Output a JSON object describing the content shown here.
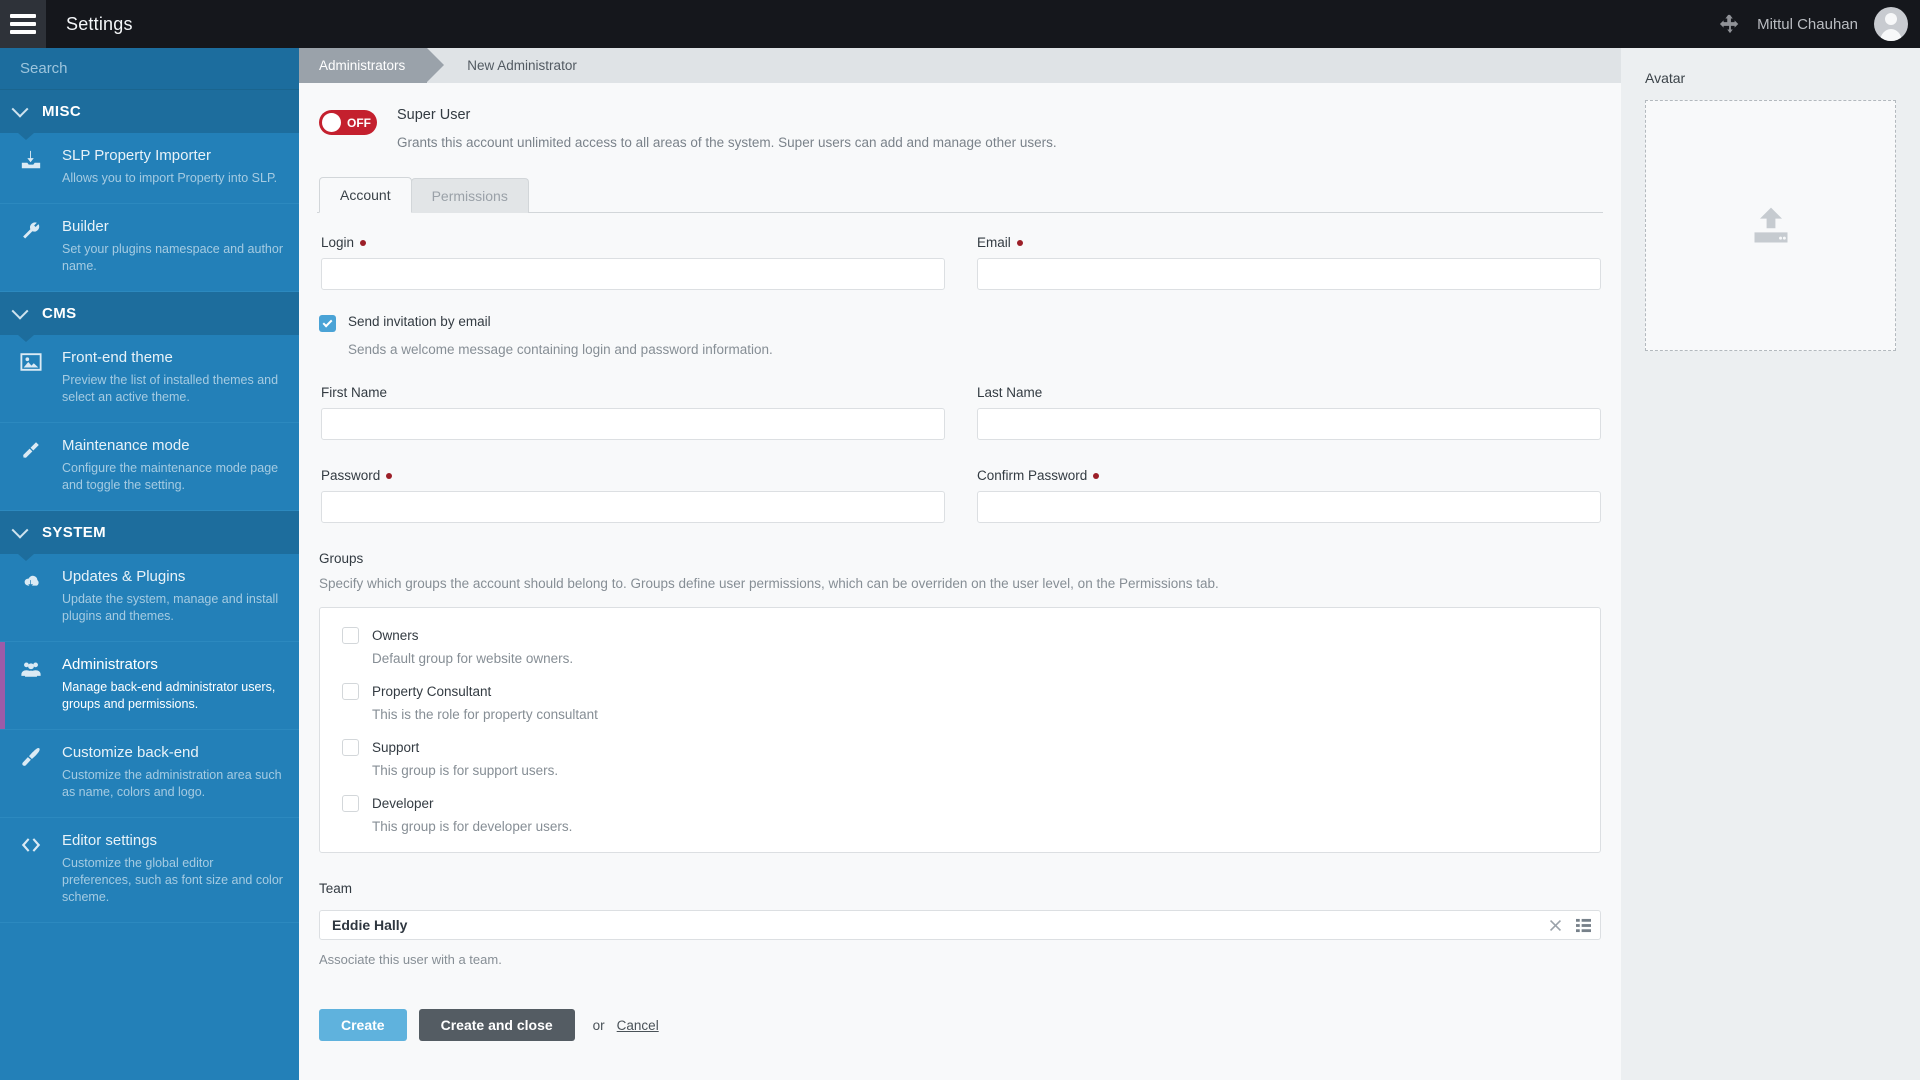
{
  "topbar": {
    "menu_icon": "hamburger-icon",
    "title": "Settings",
    "move_icon": "move-crosshair-icon",
    "user_name": "Mittul Chauhan",
    "avatar_icon": "user-avatar-icon"
  },
  "sidebar": {
    "search_placeholder": "Search",
    "groups": [
      {
        "label": "MISC",
        "items": [
          {
            "icon": "download-inbox-icon",
            "label": "SLP Property Importer",
            "desc": "Allows you to import Property into SLP.",
            "active": false
          },
          {
            "icon": "wrench-icon",
            "label": "Builder",
            "desc": "Set your plugins namespace and author name.",
            "active": false
          }
        ]
      },
      {
        "label": "CMS",
        "items": [
          {
            "icon": "image-icon",
            "label": "Front-end theme",
            "desc": "Preview the list of installed themes and select an active theme.",
            "active": false
          },
          {
            "icon": "plug-icon",
            "label": "Maintenance mode",
            "desc": "Configure the maintenance mode page and toggle the setting.",
            "active": false
          }
        ]
      },
      {
        "label": "SYSTEM",
        "items": [
          {
            "icon": "cloud-download-icon",
            "label": "Updates & Plugins",
            "desc": "Update the system, manage and install plugins and themes.",
            "active": false
          },
          {
            "icon": "users-group-icon",
            "label": "Administrators",
            "desc": "Manage back-end administrator users, groups and permissions.",
            "active": true
          },
          {
            "icon": "paint-brush-icon",
            "label": "Customize back-end",
            "desc": "Customize the administration area such as name, colors and logo.",
            "active": false
          },
          {
            "icon": "code-brackets-icon",
            "label": "Editor settings",
            "desc": "Customize the global editor preferences, such as font size and color scheme.",
            "active": false
          }
        ]
      }
    ]
  },
  "breadcrumb": {
    "first": "Administrators",
    "second": "New Administrator"
  },
  "main": {
    "super_user": {
      "toggle_state": "OFF",
      "title": "Super User",
      "desc": "Grants this account unlimited access to all areas of the system. Super users can add and manage other users."
    },
    "tabs": [
      {
        "label": "Account",
        "active": true
      },
      {
        "label": "Permissions",
        "active": false
      }
    ],
    "fields": {
      "login_label": "Login",
      "login_value": "",
      "email_label": "Email",
      "email_value": "",
      "first_name_label": "First Name",
      "first_name_value": "",
      "last_name_label": "Last Name",
      "last_name_value": "",
      "password_label": "Password",
      "password_value": "",
      "confirm_password_label": "Confirm Password",
      "confirm_password_value": ""
    },
    "invitation": {
      "checked": true,
      "label": "Send invitation by email",
      "desc": "Sends a welcome message containing login and password information."
    },
    "groups_section": {
      "label": "Groups",
      "desc": "Specify which groups the account should belong to. Groups define user permissions, which can be overriden on the user level, on the Permissions tab.",
      "items": [
        {
          "name": "Owners",
          "desc": "Default group for website owners.",
          "checked": false
        },
        {
          "name": "Property Consultant",
          "desc": "This is the role for property consultant",
          "checked": false
        },
        {
          "name": "Support",
          "desc": "This group is for support users.",
          "checked": false
        },
        {
          "name": "Developer",
          "desc": "This group is for developer users.",
          "checked": false
        }
      ]
    },
    "team": {
      "label": "Team",
      "value": "Eddie Hally",
      "clear_icon": "clear-x-icon",
      "list_icon": "list-picker-icon",
      "help": "Associate this user with a team."
    },
    "buttons": {
      "create": "Create",
      "create_and_close": "Create and close",
      "or": "or",
      "cancel": "Cancel"
    }
  },
  "right_panel": {
    "label": "Avatar",
    "upload_icon": "upload-arrow-icon"
  }
}
